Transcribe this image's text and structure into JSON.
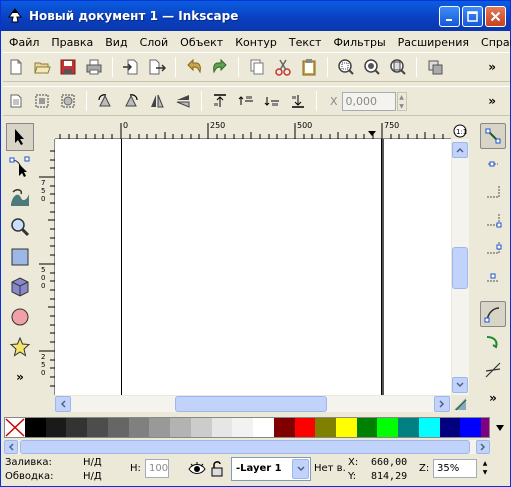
{
  "window": {
    "title": "Новый документ 1 — Inkscape",
    "controls": {
      "minimize": "_",
      "maximize": "□",
      "close": "✕"
    }
  },
  "menubar": [
    "Файл",
    "Правка",
    "Вид",
    "Слой",
    "Объект",
    "Контур",
    "Текст",
    "Фильтры",
    "Расширения",
    "Справка"
  ],
  "commands_bar": {
    "icons": [
      "new-icon",
      "open-icon",
      "save-icon",
      "print-icon",
      "import-icon",
      "export-icon",
      "undo-icon",
      "redo-icon",
      "copy-icon",
      "cut-icon",
      "paste-icon",
      "zoom-selection-icon",
      "zoom-drawing-icon",
      "zoom-page-icon",
      "duplicate-icon"
    ],
    "overflow": "»"
  },
  "tool_controls": {
    "icons": [
      "select-all-icon",
      "select-all-layers-icon",
      "deselect-icon",
      "rotate-ccw-icon",
      "rotate-cw-icon",
      "flip-horizontal-icon",
      "flip-vertical-icon",
      "raise-to-top-icon",
      "raise-icon",
      "lower-icon",
      "lower-to-bottom-icon"
    ],
    "x_label": "X",
    "x_value": "0,000",
    "overflow": "»"
  },
  "toolbox": {
    "tools": [
      "selector-tool-icon",
      "node-tool-icon",
      "tweak-tool-icon",
      "zoom-tool-icon",
      "rectangle-tool-icon",
      "3d-box-tool-icon",
      "ellipse-tool-icon",
      "star-tool-icon"
    ],
    "overflow": "»"
  },
  "ruler": {
    "h_labels": [
      "0",
      "250",
      "500",
      "750"
    ],
    "v_labels": [
      "7 5 0",
      "5 0 0",
      "2 5 0"
    ]
  },
  "snap_bar": {
    "icons": [
      "snap-toggle-icon",
      "snap-bbox-icon",
      "snap-bbox-edge-icon",
      "snap-bbox-corner-icon",
      "snap-bbox-midpoint-icon",
      "snap-bbox-center-icon",
      "snap-nodes-icon",
      "snap-path-icon",
      "snap-intersection-icon"
    ],
    "overflow": "»"
  },
  "palette": {
    "colors": [
      "#000000",
      "#1a1a1a",
      "#333333",
      "#4d4d4d",
      "#666666",
      "#808080",
      "#999999",
      "#b3b3b3",
      "#cccccc",
      "#e6e6e6",
      "#f2f2f2",
      "#ffffff",
      "#800000",
      "#ff0000",
      "#808000",
      "#ffff00",
      "#008000",
      "#00ff00",
      "#008080",
      "#00ffff",
      "#000080",
      "#0000ff",
      "#800080"
    ]
  },
  "status": {
    "fill_label": "Заливка:",
    "fill_value": "Н/Д",
    "stroke_label": "Обводка:",
    "stroke_value": "Н/Д",
    "opacity_label": "Н:",
    "opacity_value": "100",
    "layer_value": "-Layer 1",
    "message": "Нет в.",
    "x_label": "X:",
    "x_value": "660,00",
    "y_label": "Y:",
    "y_value": "814,29",
    "zoom_label": "Z:",
    "zoom_value": "35%"
  },
  "colors": {
    "titlebar": "#0a3fbf",
    "page_shadow": "#555555"
  }
}
